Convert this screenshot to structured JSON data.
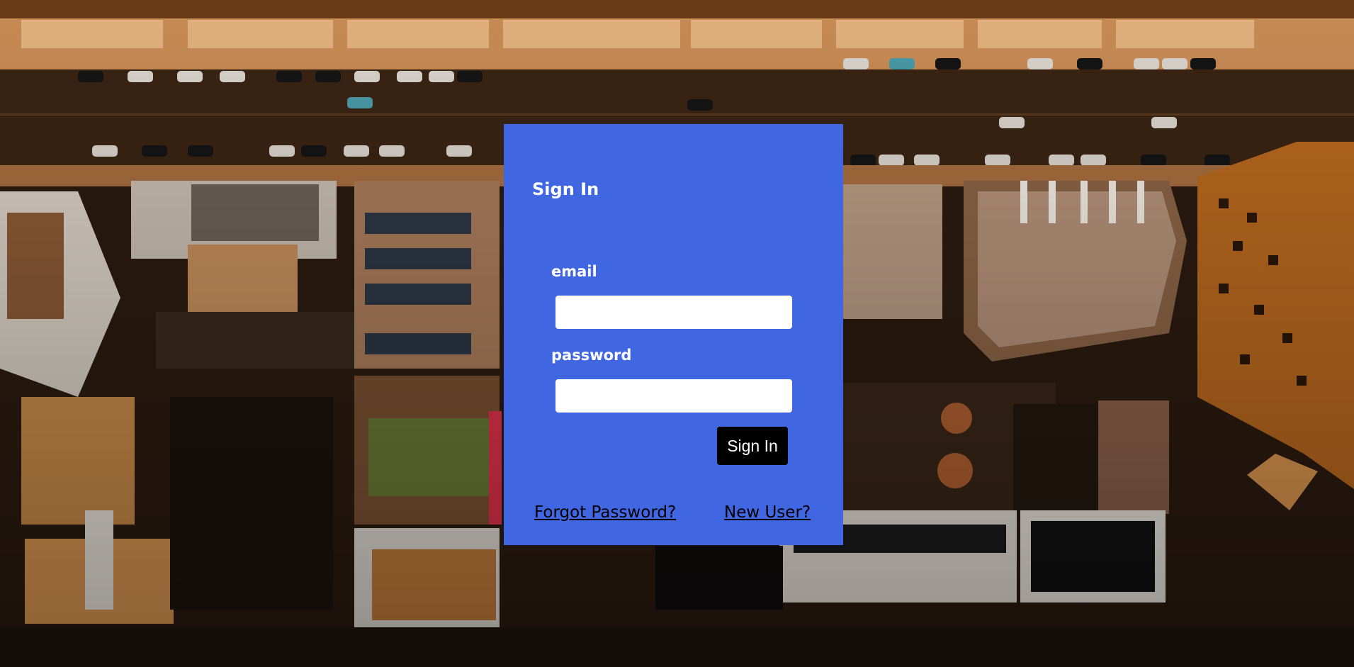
{
  "signin": {
    "title": "Sign In",
    "email_label": "email",
    "email_value": "",
    "password_label": "password",
    "password_value": "",
    "submit_label": "Sign In",
    "forgot_link": "Forgot Password?",
    "new_user_link": "New User?"
  },
  "colors": {
    "card_background": "#4166e1",
    "button_background": "#000000",
    "button_text": "#ffffff",
    "link_text": "#000000"
  }
}
